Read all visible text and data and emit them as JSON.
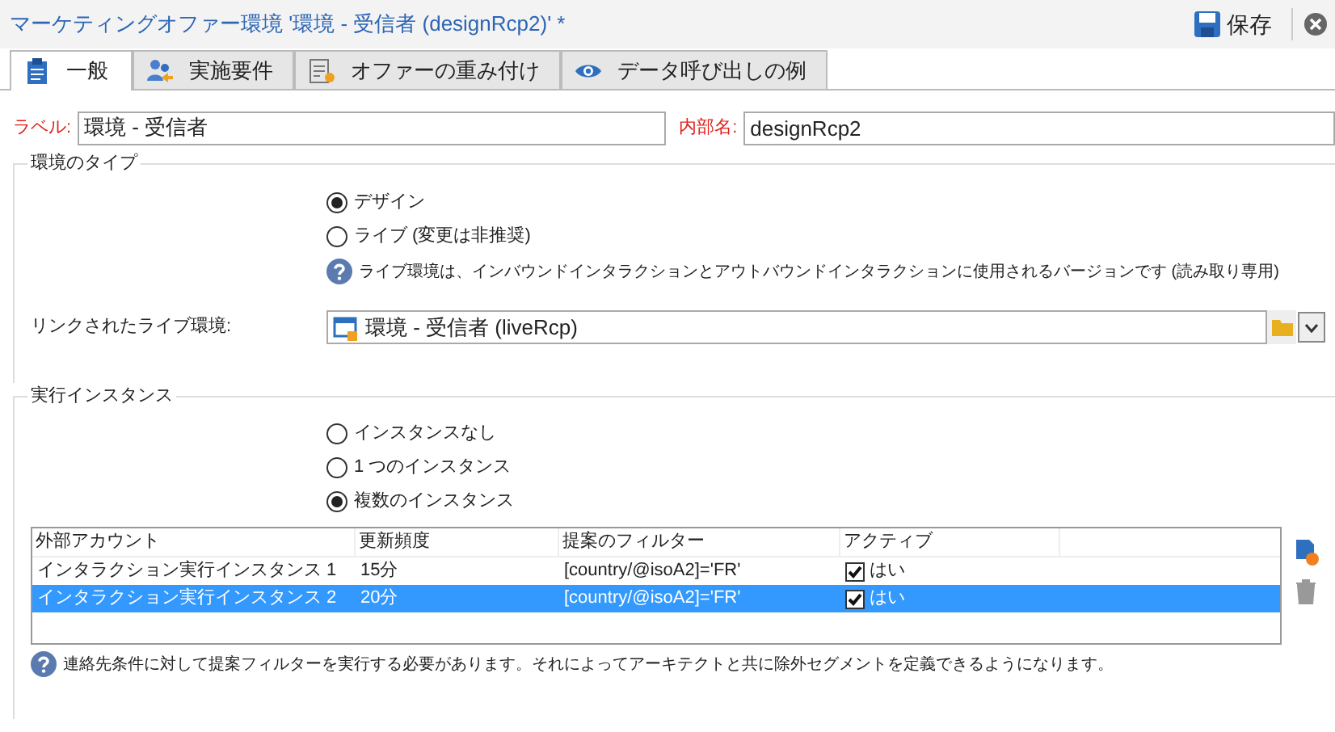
{
  "window": {
    "title": "マーケティングオファー環境 '環境 - 受信者 (designRcp2)' *",
    "save_label": "保存"
  },
  "tabs": [
    {
      "label": "一般",
      "selected": true,
      "kind": "clipboard"
    },
    {
      "label": "実施要件",
      "selected": false,
      "kind": "people"
    },
    {
      "label": "オファーの重み付け",
      "selected": false,
      "kind": "form"
    },
    {
      "label": "データ呼び出しの例",
      "selected": false,
      "kind": "eye"
    }
  ],
  "label_field": {
    "label": "ラベル:",
    "value": "環境 - 受信者"
  },
  "internal_name_field": {
    "label": "内部名:",
    "value": "designRcp2"
  },
  "environment_type": {
    "title": "環境のタイプ",
    "options": [
      {
        "label": "デザイン",
        "selected": true
      },
      {
        "label": "ライブ (変更は非推奨)",
        "selected": false
      }
    ],
    "help": "ライブ環境は、インバウンドインタラクションとアウトバウンドインタラクションに使用されるバージョンです (読み取り専用)",
    "linked_label": "リンクされたライブ環境:",
    "linked_value": "環境 - 受信者 (liveRcp)"
  },
  "execution_instances": {
    "title": "実行インスタンス",
    "options": [
      {
        "label": "インスタンスなし",
        "selected": false
      },
      {
        "label": "1 つのインスタンス",
        "selected": false
      },
      {
        "label": "複数のインスタンス",
        "selected": true
      }
    ],
    "table": {
      "columns": [
        "外部アカウント",
        "更新頻度",
        "提案のフィルター",
        "アクティブ"
      ],
      "rows": [
        {
          "cells": [
            "インタラクション実行インスタンス 1",
            "15分",
            "[country/@isoA2]='FR'"
          ],
          "active": {
            "checked": true,
            "label": "はい"
          },
          "selected": false
        },
        {
          "cells": [
            "インタラクション実行インスタンス 2",
            "20分",
            "[country/@isoA2]='FR'"
          ],
          "active": {
            "checked": true,
            "label": "はい"
          },
          "selected": true
        }
      ]
    },
    "help": "連絡先条件に対して提案フィルターを実行する必要があります。それによってアーキテクトと共に除外セグメントを定義できるようになります。"
  }
}
